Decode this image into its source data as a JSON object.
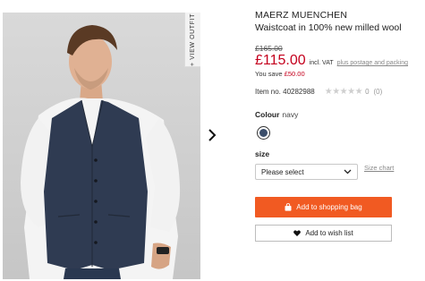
{
  "gallery": {
    "view_outfit_label": "+ VIEW OUTFIT",
    "next_icon": "chevron-right-icon"
  },
  "product": {
    "brand": "MAERZ MUENCHEN",
    "title": "Waistcoat in 100% new milled wool",
    "old_price": "£165.00",
    "price": "£115.00",
    "vat_label": "incl. VAT",
    "postage_link": "plus postage and packing",
    "savings_label": "You save",
    "savings_amount": "£50.00",
    "item_number": "Item no. 40282988",
    "rating": {
      "stars_filled": 0,
      "stars_total": 5,
      "score": "0",
      "reviews": "(0)"
    }
  },
  "colour": {
    "label": "Colour",
    "value": "navy",
    "swatch_color": "#3b4e6a"
  },
  "size": {
    "label": "size",
    "select_placeholder": "Please select",
    "size_chart_link": "Size chart"
  },
  "actions": {
    "add_to_bag": "Add to shopping bag",
    "add_to_wishlist": "Add to wish list"
  },
  "colors": {
    "price_red": "#c4001d",
    "cta_orange": "#f15a22"
  }
}
